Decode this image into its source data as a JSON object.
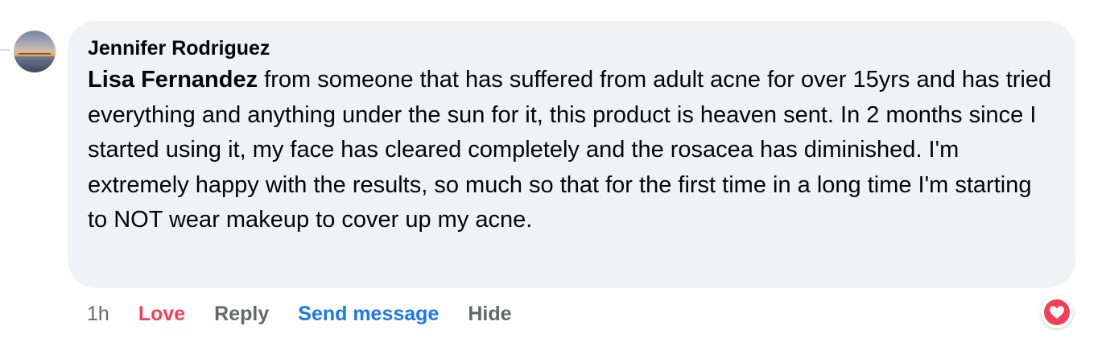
{
  "comment": {
    "author": "Jennifer Rodriguez",
    "mention": "Lisa Fernandez",
    "text": " from someone that has suffered from adult acne for over 15yrs and has tried everything and anything under the sun for it, this product is heaven sent. In 2 months since I started using it, my face has cleared completely and the rosacea has diminished. I'm extremely happy with the results, so much so that for the first time in a long time I'm starting to NOT wear makeup to cover up my acne."
  },
  "actions": {
    "time": "1h",
    "love": "Love",
    "reply": "Reply",
    "send_message": "Send message",
    "hide": "Hide"
  },
  "reaction": {
    "icon": "love-heart-icon",
    "color": "#f33e58"
  },
  "avatar": {
    "icon": "avatar-sunset-image"
  }
}
